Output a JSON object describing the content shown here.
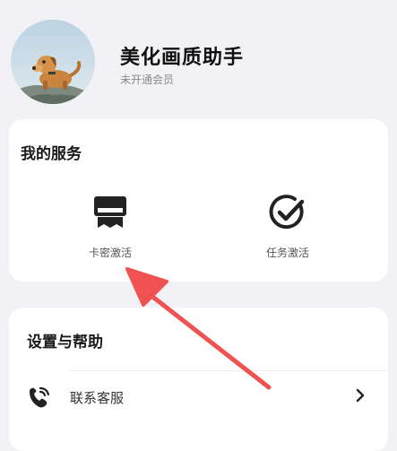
{
  "profile": {
    "app_name": "美化画质助手",
    "member_status": "未开通会员",
    "avatar_icon": "dog-avatar-icon"
  },
  "services": {
    "title": "我的服务",
    "items": [
      {
        "label": "卡密激活",
        "icon": "card-key-icon"
      },
      {
        "label": "任务激活",
        "icon": "check-circle-icon"
      }
    ]
  },
  "settings": {
    "title": "设置与帮助",
    "items": [
      {
        "label": "联系客服",
        "icon": "customer-service-icon",
        "trailing_icon": "chevron-right-icon"
      }
    ]
  },
  "colors": {
    "background": "#f2f2f6",
    "card": "#ffffff",
    "icon": "#222222",
    "annotation_arrow": "#f05252"
  }
}
